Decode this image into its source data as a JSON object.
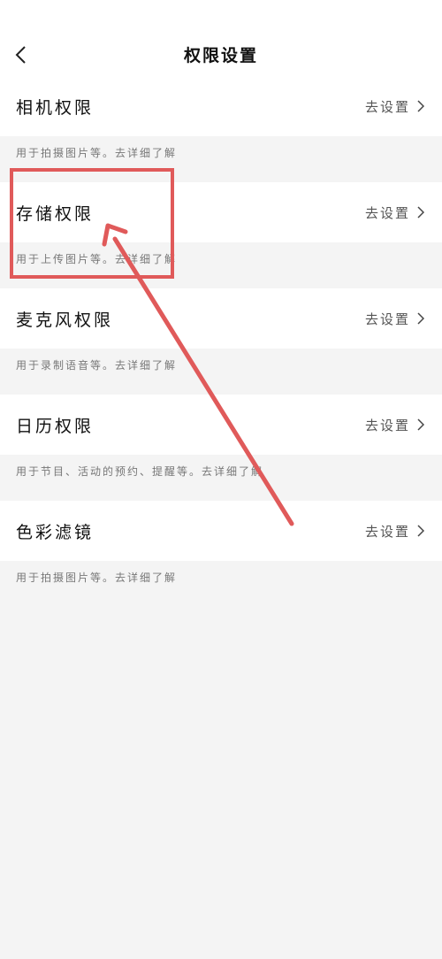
{
  "header": {
    "title": "权限设置"
  },
  "items": [
    {
      "title": "相机权限",
      "action": "去设置",
      "desc": "用于拍摄图片等。去详细了解"
    },
    {
      "title": "存储权限",
      "action": "去设置",
      "desc": "用于上传图片等。去详细了解"
    },
    {
      "title": "麦克风权限",
      "action": "去设置",
      "desc": "用于录制语音等。去详细了解"
    },
    {
      "title": "日历权限",
      "action": "去设置",
      "desc": "用于节目、活动的预约、提醒等。去详细了解"
    },
    {
      "title": "色彩滤镜",
      "action": "去设置",
      "desc": "用于拍摄图片等。去详细了解"
    }
  ],
  "annotation": {
    "color": "#e05a5a",
    "target": "存储权限"
  }
}
